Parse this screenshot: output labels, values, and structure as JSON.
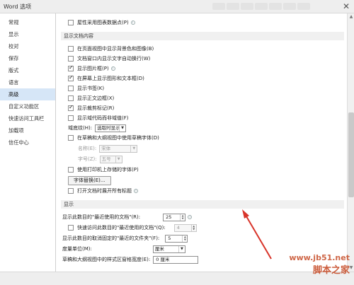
{
  "window": {
    "title": "Word 选项",
    "close_label": "✕"
  },
  "sidebar": {
    "items": [
      {
        "label": "常规"
      },
      {
        "label": "显示"
      },
      {
        "label": "校对"
      },
      {
        "label": "保存"
      },
      {
        "label": "版式"
      },
      {
        "label": "语言"
      },
      {
        "label": "高级",
        "active": true
      },
      {
        "label": "自定义功能区"
      },
      {
        "label": "快速访问工具栏"
      },
      {
        "label": "加载项"
      },
      {
        "label": "信任中心"
      }
    ]
  },
  "top_option": {
    "label": "屋性采用图表数据点(P)",
    "checked": false
  },
  "doc_content": {
    "header": "显示文档内容",
    "options": [
      {
        "label": "在页面视图中显示背景色和图像(B)",
        "checked": false
      },
      {
        "label": "文档窗口内显示文字自动换行(W)",
        "checked": false
      },
      {
        "label": "显示图片框(P)",
        "checked": true,
        "info": true
      },
      {
        "label": "在屏幕上显示图形和文本框(D)",
        "checked": true
      },
      {
        "label": "显示书签(K)",
        "checked": false
      },
      {
        "label": "显示正文边框(X)",
        "checked": false
      },
      {
        "label": "显示裁剪标记(R)",
        "checked": true
      },
      {
        "label": "显示域代码而非域值(F)",
        "checked": false
      }
    ],
    "field_shading": {
      "label": "域底纹(H):",
      "value": "选取时显示"
    },
    "draft_font": {
      "label": "在草稿和大纲视图中使用草稿字体(D)",
      "checked": false
    },
    "font_name": {
      "label": "名称(E):",
      "value": "宋体"
    },
    "font_size": {
      "label": "字号(Z):",
      "value": "五号"
    },
    "printer_fonts": {
      "label": "使用打印机上存储的字体(P)",
      "checked": false
    },
    "font_sub_button": "字体替换(E)...",
    "expand_headings": {
      "label": "打开文档时展开所有标题",
      "checked": false,
      "info": true
    }
  },
  "display": {
    "header": "显示",
    "recent_docs": {
      "label": "显示此数目的\"最近使用的文档\"(R):",
      "value": "25"
    },
    "quick_access": {
      "label": "快速访问此数目的\"最近使用的文档\"(Q):",
      "value": "4",
      "checked": false
    },
    "recent_folders": {
      "label": "显示此数目的取消固定的\"最近的文件夹\"(F):",
      "value": "5"
    },
    "units": {
      "label": "度量单位(M):",
      "value": "厘米"
    },
    "style_width": {
      "label": "草稿和大纲视图中的样式区窗格宽度(E):",
      "value": "0 厘米"
    }
  },
  "watermark": {
    "top": "www.jb51.net",
    "bottom": "脚本之家"
  },
  "colors": {
    "accent": "#d6e6f7",
    "annotation": "#d8342a"
  }
}
